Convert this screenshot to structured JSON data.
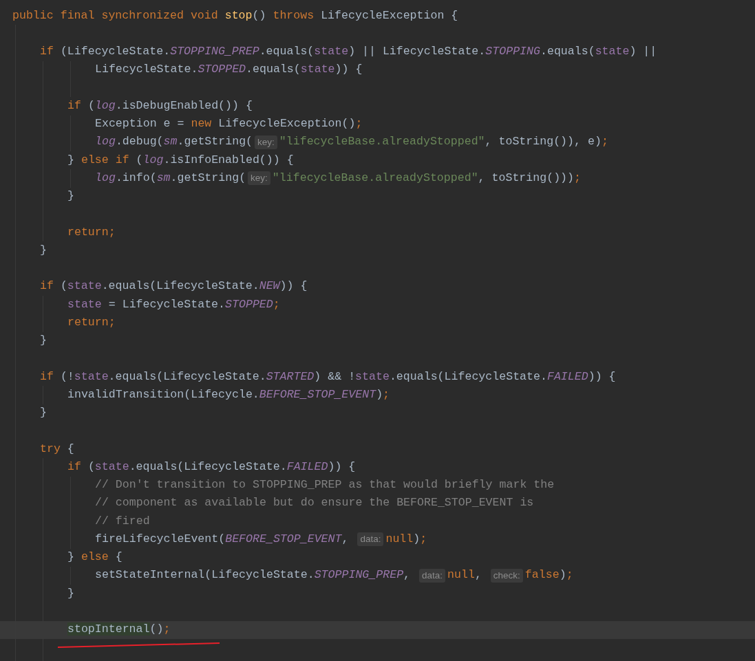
{
  "editor": {
    "lines": [
      {
        "tokens": [
          {
            "kind": "keyword",
            "text": "public final synchronized void "
          },
          {
            "kind": "method",
            "text": "stop"
          },
          {
            "kind": "plain",
            "text": "() "
          },
          {
            "kind": "keyword",
            "text": "throws "
          },
          {
            "kind": "plain",
            "text": "LifecycleException {"
          }
        ]
      },
      {
        "space_before": true,
        "tokens": [
          {
            "kind": "keyword",
            "text": "    if "
          },
          {
            "kind": "plain",
            "text": "(LifecycleState."
          },
          {
            "kind": "static",
            "text": "STOPPING_PREP"
          },
          {
            "kind": "plain",
            "text": ".equals("
          },
          {
            "kind": "field",
            "text": "state"
          },
          {
            "kind": "plain",
            "text": ") || LifecycleState."
          },
          {
            "kind": "static",
            "text": "STOPPING"
          },
          {
            "kind": "plain",
            "text": ".equals("
          },
          {
            "kind": "field",
            "text": "state"
          },
          {
            "kind": "plain",
            "text": ") ||"
          }
        ]
      },
      {
        "tokens": [
          {
            "kind": "plain",
            "text": "            LifecycleState."
          },
          {
            "kind": "static",
            "text": "STOPPED"
          },
          {
            "kind": "plain",
            "text": ".equals("
          },
          {
            "kind": "field",
            "text": "state"
          },
          {
            "kind": "plain",
            "text": ")) {"
          }
        ]
      },
      {
        "space_before": true,
        "tokens": [
          {
            "kind": "keyword",
            "text": "        if "
          },
          {
            "kind": "plain",
            "text": "("
          },
          {
            "kind": "static",
            "text": "log"
          },
          {
            "kind": "plain",
            "text": ".isDebugEnabled()) {"
          }
        ]
      },
      {
        "tokens": [
          {
            "kind": "plain",
            "text": "            Exception e = "
          },
          {
            "kind": "keyword",
            "text": "new "
          },
          {
            "kind": "plain",
            "text": "LifecycleException()"
          },
          {
            "kind": "semicolon",
            "text": ";"
          }
        ]
      },
      {
        "tokens": [
          {
            "kind": "static",
            "text": "            log"
          },
          {
            "kind": "plain",
            "text": ".debug("
          },
          {
            "kind": "static",
            "text": "sm"
          },
          {
            "kind": "plain",
            "text": ".getString("
          },
          {
            "kind": "hint",
            "text": "key:"
          },
          {
            "kind": "string",
            "text": "\"lifecycleBase.alreadyStopped\""
          },
          {
            "kind": "plain",
            "text": ", toString()), e)"
          },
          {
            "kind": "semicolon",
            "text": ";"
          }
        ]
      },
      {
        "tokens": [
          {
            "kind": "plain",
            "text": "        } "
          },
          {
            "kind": "keyword",
            "text": "else if "
          },
          {
            "kind": "plain",
            "text": "("
          },
          {
            "kind": "static",
            "text": "log"
          },
          {
            "kind": "plain",
            "text": ".isInfoEnabled()) {"
          }
        ]
      },
      {
        "tokens": [
          {
            "kind": "static",
            "text": "            log"
          },
          {
            "kind": "plain",
            "text": ".info("
          },
          {
            "kind": "static",
            "text": "sm"
          },
          {
            "kind": "plain",
            "text": ".getString("
          },
          {
            "kind": "hint",
            "text": "key:"
          },
          {
            "kind": "string",
            "text": "\"lifecycleBase.alreadyStopped\""
          },
          {
            "kind": "plain",
            "text": ", toString()))"
          },
          {
            "kind": "semicolon",
            "text": ";"
          }
        ]
      },
      {
        "tokens": [
          {
            "kind": "plain",
            "text": "        }"
          }
        ]
      },
      {
        "space_before": true,
        "tokens": [
          {
            "kind": "keyword",
            "text": "        return"
          },
          {
            "kind": "semicolon",
            "text": ";"
          }
        ]
      },
      {
        "tokens": [
          {
            "kind": "plain",
            "text": "    }"
          }
        ]
      },
      {
        "space_before": true,
        "tokens": [
          {
            "kind": "keyword",
            "text": "    if "
          },
          {
            "kind": "plain",
            "text": "("
          },
          {
            "kind": "field",
            "text": "state"
          },
          {
            "kind": "plain",
            "text": ".equals(LifecycleState."
          },
          {
            "kind": "static",
            "text": "NEW"
          },
          {
            "kind": "plain",
            "text": ")) {"
          }
        ]
      },
      {
        "tokens": [
          {
            "kind": "field",
            "text": "        state"
          },
          {
            "kind": "plain",
            "text": " = LifecycleState."
          },
          {
            "kind": "static",
            "text": "STOPPED"
          },
          {
            "kind": "semicolon",
            "text": ";"
          }
        ]
      },
      {
        "tokens": [
          {
            "kind": "keyword",
            "text": "        return"
          },
          {
            "kind": "semicolon",
            "text": ";"
          }
        ]
      },
      {
        "tokens": [
          {
            "kind": "plain",
            "text": "    }"
          }
        ]
      },
      {
        "space_before": true,
        "tokens": [
          {
            "kind": "keyword",
            "text": "    if "
          },
          {
            "kind": "plain",
            "text": "(!"
          },
          {
            "kind": "field",
            "text": "state"
          },
          {
            "kind": "plain",
            "text": ".equals(LifecycleState."
          },
          {
            "kind": "static",
            "text": "STARTED"
          },
          {
            "kind": "plain",
            "text": ") && !"
          },
          {
            "kind": "field",
            "text": "state"
          },
          {
            "kind": "plain",
            "text": ".equals(LifecycleState."
          },
          {
            "kind": "static",
            "text": "FAILED"
          },
          {
            "kind": "plain",
            "text": ")) {"
          }
        ]
      },
      {
        "tokens": [
          {
            "kind": "plain",
            "text": "        invalidTransition(Lifecycle."
          },
          {
            "kind": "static",
            "text": "BEFORE_STOP_EVENT"
          },
          {
            "kind": "plain",
            "text": ")"
          },
          {
            "kind": "semicolon",
            "text": ";"
          }
        ]
      },
      {
        "tokens": [
          {
            "kind": "plain",
            "text": "    }"
          }
        ]
      },
      {
        "space_before": true,
        "tokens": [
          {
            "kind": "keyword",
            "text": "    try "
          },
          {
            "kind": "plain",
            "text": "{"
          }
        ]
      },
      {
        "tokens": [
          {
            "kind": "keyword",
            "text": "        if "
          },
          {
            "kind": "plain",
            "text": "("
          },
          {
            "kind": "field",
            "text": "state"
          },
          {
            "kind": "plain",
            "text": ".equals(LifecycleState."
          },
          {
            "kind": "static",
            "text": "FAILED"
          },
          {
            "kind": "plain",
            "text": ")) {"
          }
        ]
      },
      {
        "tokens": [
          {
            "kind": "comment",
            "text": "            // Don't transition to STOPPING_PREP as that would briefly mark the"
          }
        ]
      },
      {
        "tokens": [
          {
            "kind": "comment",
            "text": "            // component as available but do ensure the BEFORE_STOP_EVENT is"
          }
        ]
      },
      {
        "tokens": [
          {
            "kind": "comment",
            "text": "            // fired"
          }
        ]
      },
      {
        "tokens": [
          {
            "kind": "plain",
            "text": "            fireLifecycleEvent("
          },
          {
            "kind": "static",
            "text": "BEFORE_STOP_EVENT"
          },
          {
            "kind": "plain",
            "text": ", "
          },
          {
            "kind": "hint",
            "text": "data:"
          },
          {
            "kind": "keyword",
            "text": "null"
          },
          {
            "kind": "plain",
            "text": ")"
          },
          {
            "kind": "semicolon",
            "text": ";"
          }
        ]
      },
      {
        "tokens": [
          {
            "kind": "plain",
            "text": "        } "
          },
          {
            "kind": "keyword",
            "text": "else "
          },
          {
            "kind": "plain",
            "text": "{"
          }
        ]
      },
      {
        "tokens": [
          {
            "kind": "plain",
            "text": "            setStateInternal(LifecycleState."
          },
          {
            "kind": "static",
            "text": "STOPPING_PREP"
          },
          {
            "kind": "plain",
            "text": ", "
          },
          {
            "kind": "hint",
            "text": "data:"
          },
          {
            "kind": "keyword",
            "text": "null"
          },
          {
            "kind": "plain",
            "text": ", "
          },
          {
            "kind": "hint",
            "text": "check:"
          },
          {
            "kind": "keyword",
            "text": "false"
          },
          {
            "kind": "plain",
            "text": ")"
          },
          {
            "kind": "semicolon",
            "text": ";"
          }
        ]
      },
      {
        "tokens": [
          {
            "kind": "plain",
            "text": "        }"
          }
        ]
      },
      {
        "space_before": true,
        "current": true,
        "tokens": [
          {
            "kind": "match",
            "text": "        stopInternal"
          },
          {
            "kind": "plain",
            "text": "()"
          },
          {
            "kind": "semicolon",
            "text": ";"
          }
        ]
      }
    ]
  }
}
